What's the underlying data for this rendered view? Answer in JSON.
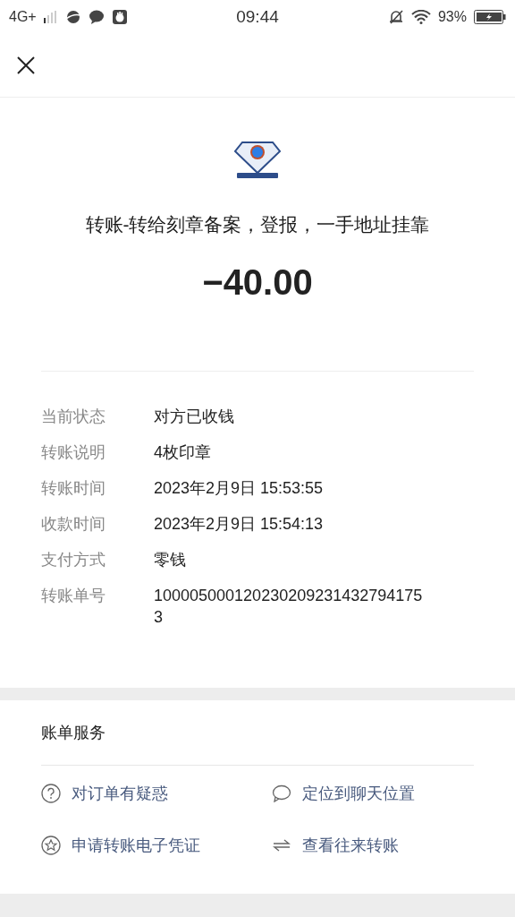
{
  "status_bar": {
    "network": "4G+",
    "time": "09:44",
    "battery": "93%"
  },
  "title": "转账-转给刻章备案，登报，一手地址挂靠",
  "amount": "−40.00",
  "details": [
    {
      "label": "当前状态",
      "value": "对方已收钱"
    },
    {
      "label": "转账说明",
      "value": "4枚印章"
    },
    {
      "label": "转账时间",
      "value": "2023年2月9日 15:53:55"
    },
    {
      "label": "收款时间",
      "value": "2023年2月9日 15:54:13"
    },
    {
      "label": "支付方式",
      "value": "零钱"
    },
    {
      "label": "转账单号",
      "value": "1000050001202302092314327941753"
    }
  ],
  "services": {
    "title": "账单服务",
    "items": [
      {
        "kind": "question",
        "label": "对订单有疑惑"
      },
      {
        "kind": "chat",
        "label": "定位到聊天位置"
      },
      {
        "kind": "star",
        "label": "申请转账电子凭证"
      },
      {
        "kind": "swap",
        "label": "查看往来转账"
      }
    ]
  }
}
